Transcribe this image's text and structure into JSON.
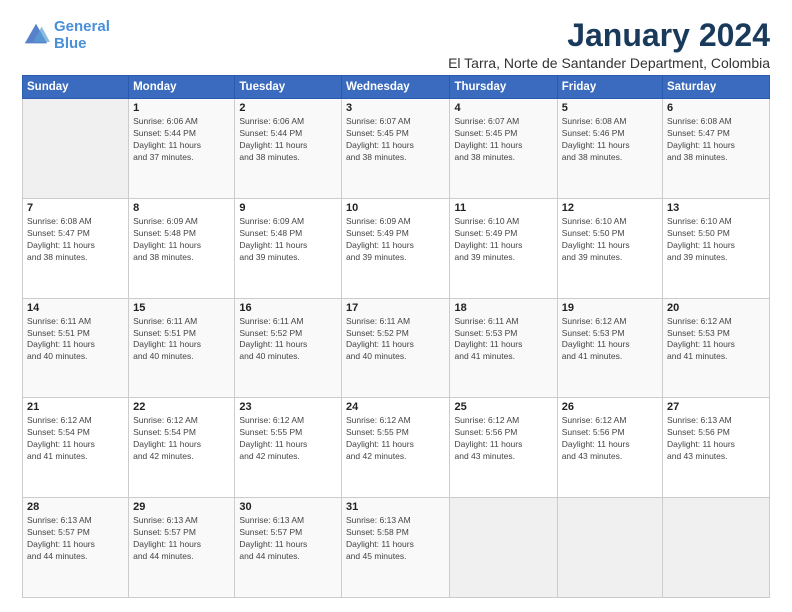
{
  "logo": {
    "line1": "General",
    "line2": "Blue"
  },
  "title": "January 2024",
  "location": "El Tarra, Norte de Santander Department, Colombia",
  "weekdays": [
    "Sunday",
    "Monday",
    "Tuesday",
    "Wednesday",
    "Thursday",
    "Friday",
    "Saturday"
  ],
  "weeks": [
    [
      {
        "day": "",
        "info": ""
      },
      {
        "day": "1",
        "info": "Sunrise: 6:06 AM\nSunset: 5:44 PM\nDaylight: 11 hours\nand 37 minutes."
      },
      {
        "day": "2",
        "info": "Sunrise: 6:06 AM\nSunset: 5:44 PM\nDaylight: 11 hours\nand 38 minutes."
      },
      {
        "day": "3",
        "info": "Sunrise: 6:07 AM\nSunset: 5:45 PM\nDaylight: 11 hours\nand 38 minutes."
      },
      {
        "day": "4",
        "info": "Sunrise: 6:07 AM\nSunset: 5:45 PM\nDaylight: 11 hours\nand 38 minutes."
      },
      {
        "day": "5",
        "info": "Sunrise: 6:08 AM\nSunset: 5:46 PM\nDaylight: 11 hours\nand 38 minutes."
      },
      {
        "day": "6",
        "info": "Sunrise: 6:08 AM\nSunset: 5:47 PM\nDaylight: 11 hours\nand 38 minutes."
      }
    ],
    [
      {
        "day": "7",
        "info": "Sunrise: 6:08 AM\nSunset: 5:47 PM\nDaylight: 11 hours\nand 38 minutes."
      },
      {
        "day": "8",
        "info": "Sunrise: 6:09 AM\nSunset: 5:48 PM\nDaylight: 11 hours\nand 38 minutes."
      },
      {
        "day": "9",
        "info": "Sunrise: 6:09 AM\nSunset: 5:48 PM\nDaylight: 11 hours\nand 39 minutes."
      },
      {
        "day": "10",
        "info": "Sunrise: 6:09 AM\nSunset: 5:49 PM\nDaylight: 11 hours\nand 39 minutes."
      },
      {
        "day": "11",
        "info": "Sunrise: 6:10 AM\nSunset: 5:49 PM\nDaylight: 11 hours\nand 39 minutes."
      },
      {
        "day": "12",
        "info": "Sunrise: 6:10 AM\nSunset: 5:50 PM\nDaylight: 11 hours\nand 39 minutes."
      },
      {
        "day": "13",
        "info": "Sunrise: 6:10 AM\nSunset: 5:50 PM\nDaylight: 11 hours\nand 39 minutes."
      }
    ],
    [
      {
        "day": "14",
        "info": "Sunrise: 6:11 AM\nSunset: 5:51 PM\nDaylight: 11 hours\nand 40 minutes."
      },
      {
        "day": "15",
        "info": "Sunrise: 6:11 AM\nSunset: 5:51 PM\nDaylight: 11 hours\nand 40 minutes."
      },
      {
        "day": "16",
        "info": "Sunrise: 6:11 AM\nSunset: 5:52 PM\nDaylight: 11 hours\nand 40 minutes."
      },
      {
        "day": "17",
        "info": "Sunrise: 6:11 AM\nSunset: 5:52 PM\nDaylight: 11 hours\nand 40 minutes."
      },
      {
        "day": "18",
        "info": "Sunrise: 6:11 AM\nSunset: 5:53 PM\nDaylight: 11 hours\nand 41 minutes."
      },
      {
        "day": "19",
        "info": "Sunrise: 6:12 AM\nSunset: 5:53 PM\nDaylight: 11 hours\nand 41 minutes."
      },
      {
        "day": "20",
        "info": "Sunrise: 6:12 AM\nSunset: 5:53 PM\nDaylight: 11 hours\nand 41 minutes."
      }
    ],
    [
      {
        "day": "21",
        "info": "Sunrise: 6:12 AM\nSunset: 5:54 PM\nDaylight: 11 hours\nand 41 minutes."
      },
      {
        "day": "22",
        "info": "Sunrise: 6:12 AM\nSunset: 5:54 PM\nDaylight: 11 hours\nand 42 minutes."
      },
      {
        "day": "23",
        "info": "Sunrise: 6:12 AM\nSunset: 5:55 PM\nDaylight: 11 hours\nand 42 minutes."
      },
      {
        "day": "24",
        "info": "Sunrise: 6:12 AM\nSunset: 5:55 PM\nDaylight: 11 hours\nand 42 minutes."
      },
      {
        "day": "25",
        "info": "Sunrise: 6:12 AM\nSunset: 5:56 PM\nDaylight: 11 hours\nand 43 minutes."
      },
      {
        "day": "26",
        "info": "Sunrise: 6:12 AM\nSunset: 5:56 PM\nDaylight: 11 hours\nand 43 minutes."
      },
      {
        "day": "27",
        "info": "Sunrise: 6:13 AM\nSunset: 5:56 PM\nDaylight: 11 hours\nand 43 minutes."
      }
    ],
    [
      {
        "day": "28",
        "info": "Sunrise: 6:13 AM\nSunset: 5:57 PM\nDaylight: 11 hours\nand 44 minutes."
      },
      {
        "day": "29",
        "info": "Sunrise: 6:13 AM\nSunset: 5:57 PM\nDaylight: 11 hours\nand 44 minutes."
      },
      {
        "day": "30",
        "info": "Sunrise: 6:13 AM\nSunset: 5:57 PM\nDaylight: 11 hours\nand 44 minutes."
      },
      {
        "day": "31",
        "info": "Sunrise: 6:13 AM\nSunset: 5:58 PM\nDaylight: 11 hours\nand 45 minutes."
      },
      {
        "day": "",
        "info": ""
      },
      {
        "day": "",
        "info": ""
      },
      {
        "day": "",
        "info": ""
      }
    ]
  ]
}
